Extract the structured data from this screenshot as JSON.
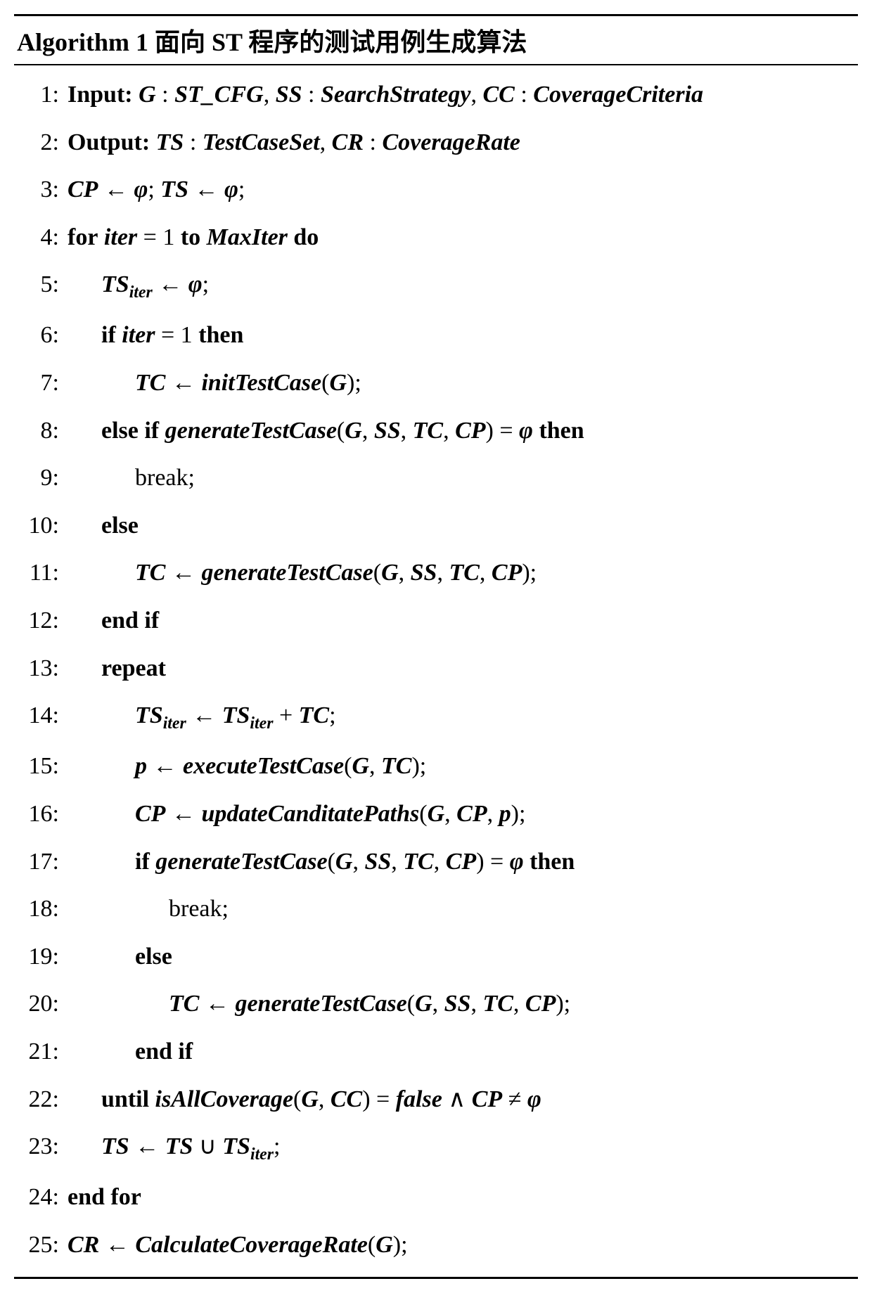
{
  "algorithm": {
    "header_prefix": "Algorithm 1",
    "header_title": "面向 ST 程序的测试用例生成算法",
    "lines": [
      {
        "n": "1:",
        "indent": 0,
        "html": "<span class='kw'>Input:</span> <span class='it'>G</span> : <span class='it'>ST_CFG</span>, <span class='it'>SS</span> : <span class='it'>SearchStrategy</span>, <span class='it'>CC</span> : <span class='it'>CoverageCriteria</span>"
      },
      {
        "n": "2:",
        "indent": 0,
        "html": "<span class='kw'>Output:</span> <span class='it'>TS</span> : <span class='it'>TestCaseSet</span>, <span class='it'>CR</span> : <span class='it'>CoverageRate</span>"
      },
      {
        "n": "3:",
        "indent": 0,
        "html": "<span class='it'>CP</span> ← <span class='it'>φ</span>; <span class='it'>TS</span> ← <span class='it'>φ</span>;"
      },
      {
        "n": "4:",
        "indent": 0,
        "html": "<span class='kw'>for</span> <span class='it'>iter</span> = 1 <span class='kw'>to</span> <span class='it'>MaxIter</span> <span class='kw'>do</span>"
      },
      {
        "n": "5:",
        "indent": 1,
        "html": "<span class='it'>TS</span><span class='sub'>iter</span> ← <span class='it'>φ</span>;"
      },
      {
        "n": "6:",
        "indent": 1,
        "html": "<span class='kw'>if</span> <span class='it'>iter</span> = 1 <span class='kw'>then</span>"
      },
      {
        "n": "7:",
        "indent": 2,
        "html": "<span class='it'>TC</span> ← <span class='it'>initTestCase</span>(<span class='it'>G</span>);"
      },
      {
        "n": "8:",
        "indent": 1,
        "html": "<span class='kw'>else if</span> <span class='it'>generateTestCase</span>(<span class='it'>G</span>,&nbsp;<span class='it'>SS</span>,&nbsp;<span class='it'>TC</span>,&nbsp;<span class='it'>CP</span>) = <span class='it'>φ</span> <span class='kw'>then</span>"
      },
      {
        "n": "9:",
        "indent": 2,
        "html": "break;"
      },
      {
        "n": "10:",
        "indent": 1,
        "html": "<span class='kw'>else</span>"
      },
      {
        "n": "11:",
        "indent": 2,
        "html": "<span class='it'>TC</span> ← <span class='it'>generateTestCase</span>(<span class='it'>G</span>,&nbsp;<span class='it'>SS</span>,&nbsp;<span class='it'>TC</span>,&nbsp;<span class='it'>CP</span>);"
      },
      {
        "n": "12:",
        "indent": 1,
        "html": "<span class='kw'>end if</span>"
      },
      {
        "n": "13:",
        "indent": 1,
        "html": "<span class='kw'>repeat</span>"
      },
      {
        "n": "14:",
        "indent": 2,
        "html": "<span class='it'>TS</span><span class='sub'>iter</span> ← <span class='it'>TS</span><span class='sub'>iter</span> + <span class='it'>TC</span>;"
      },
      {
        "n": "15:",
        "indent": 2,
        "html": "<span class='it'>p</span> ← <span class='it'>executeTestCase</span>(<span class='it'>G</span>,&nbsp;<span class='it'>TC</span>);"
      },
      {
        "n": "16:",
        "indent": 2,
        "html": "<span class='it'>CP</span> ← <span class='it'>updateCanditatePaths</span>(<span class='it'>G</span>,&nbsp;<span class='it'>CP</span>,&nbsp;<span class='it'>p</span>);"
      },
      {
        "n": "17:",
        "indent": 2,
        "html": "<span class='kw'>if</span> <span class='it'>generateTestCase</span>(<span class='it'>G</span>,&nbsp;<span class='it'>SS</span>,&nbsp;<span class='it'>TC</span>,&nbsp;<span class='it'>CP</span>) = <span class='it'>φ</span> <span class='kw'>then</span>"
      },
      {
        "n": "18:",
        "indent": 3,
        "html": "break;"
      },
      {
        "n": "19:",
        "indent": 2,
        "html": "<span class='kw'>else</span>"
      },
      {
        "n": "20:",
        "indent": 3,
        "html": "<span class='it'>TC</span> ← <span class='it'>generateTestCase</span>(<span class='it'>G</span>,&nbsp;<span class='it'>SS</span>,&nbsp;<span class='it'>TC</span>,&nbsp;<span class='it'>CP</span>);"
      },
      {
        "n": "21:",
        "indent": 2,
        "html": "<span class='kw'>end if</span>"
      },
      {
        "n": "22:",
        "indent": 1,
        "html": "<span class='kw'>until</span> <span class='it'>isAllCoverage</span>(<span class='it'>G</span>,&nbsp;<span class='it'>CC</span>) = <span class='it'>false</span> ∧ <span class='it'>CP</span> ≠ <span class='it'>φ</span>"
      },
      {
        "n": "23:",
        "indent": 1,
        "html": "<span class='it'>TS</span> ← <span class='it'>TS</span> ∪ <span class='it'>TS</span><span class='sub'>iter</span>;"
      },
      {
        "n": "24:",
        "indent": 0,
        "html": "<span class='kw'>end for</span>"
      },
      {
        "n": "25:",
        "indent": 0,
        "html": "<span class='it'>CR</span> ← <span class='it'>CalculateCoverageRate</span>(<span class='it'>G</span>);"
      }
    ]
  }
}
